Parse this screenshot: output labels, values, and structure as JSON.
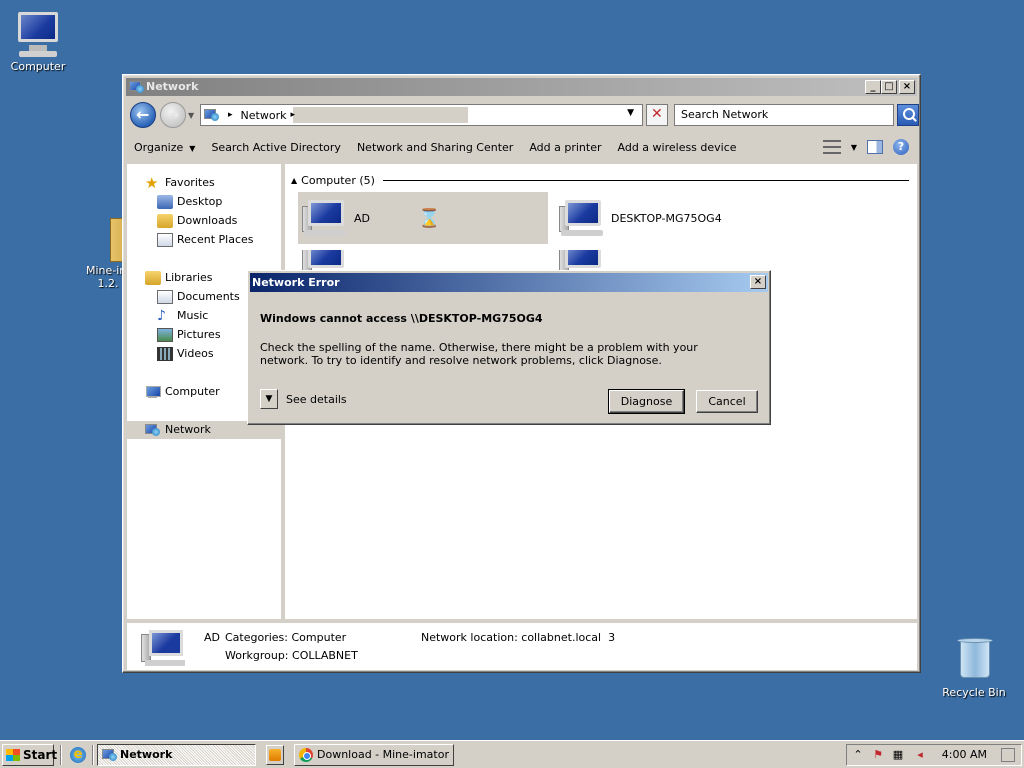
{
  "desktop": {
    "icons": [
      {
        "label": "Computer"
      },
      {
        "label": "Mine-im",
        "label2": "1.2."
      },
      {
        "label": "Recycle Bin"
      }
    ]
  },
  "explorer": {
    "title": "Network",
    "address": {
      "segment": "Network"
    },
    "search_placeholder": "Search Network",
    "commands": [
      "Organize",
      "Search Active Directory",
      "Network and Sharing Center",
      "Add a printer",
      "Add a wireless device"
    ],
    "nav": {
      "favorites": "Favorites",
      "favorites_items": [
        "Desktop",
        "Downloads",
        "Recent Places"
      ],
      "libraries": "Libraries",
      "libraries_items": [
        "Documents",
        "Music",
        "Pictures",
        "Videos"
      ],
      "computer": "Computer",
      "network": "Network"
    },
    "group_header": "Computer (5)",
    "tiles": [
      "AD",
      "DESKTOP-MG75OG4"
    ],
    "details": {
      "name": "AD",
      "categories_label": "Categories:",
      "categories_value": "Computer",
      "workgroup_label": "Workgroup:",
      "workgroup_value": "COLLABNET",
      "location_label": "Network location:",
      "location_value": "collabnet.local",
      "location_count": "3"
    }
  },
  "dialog": {
    "title": "Network Error",
    "heading": "Windows cannot access \\\\DESKTOP-MG75OG4",
    "body": "Check the spelling of the name. Otherwise, there might be a problem with your network. To try to identify and resolve network problems, click Diagnose.",
    "see_details": "See details",
    "diagnose": "Diagnose",
    "cancel": "Cancel"
  },
  "taskbar": {
    "start": "Start",
    "tasks": [
      {
        "label": "Network",
        "active": true
      },
      {
        "label": "Download - Mine-imator -..."
      }
    ],
    "clock": "4:00 AM"
  }
}
